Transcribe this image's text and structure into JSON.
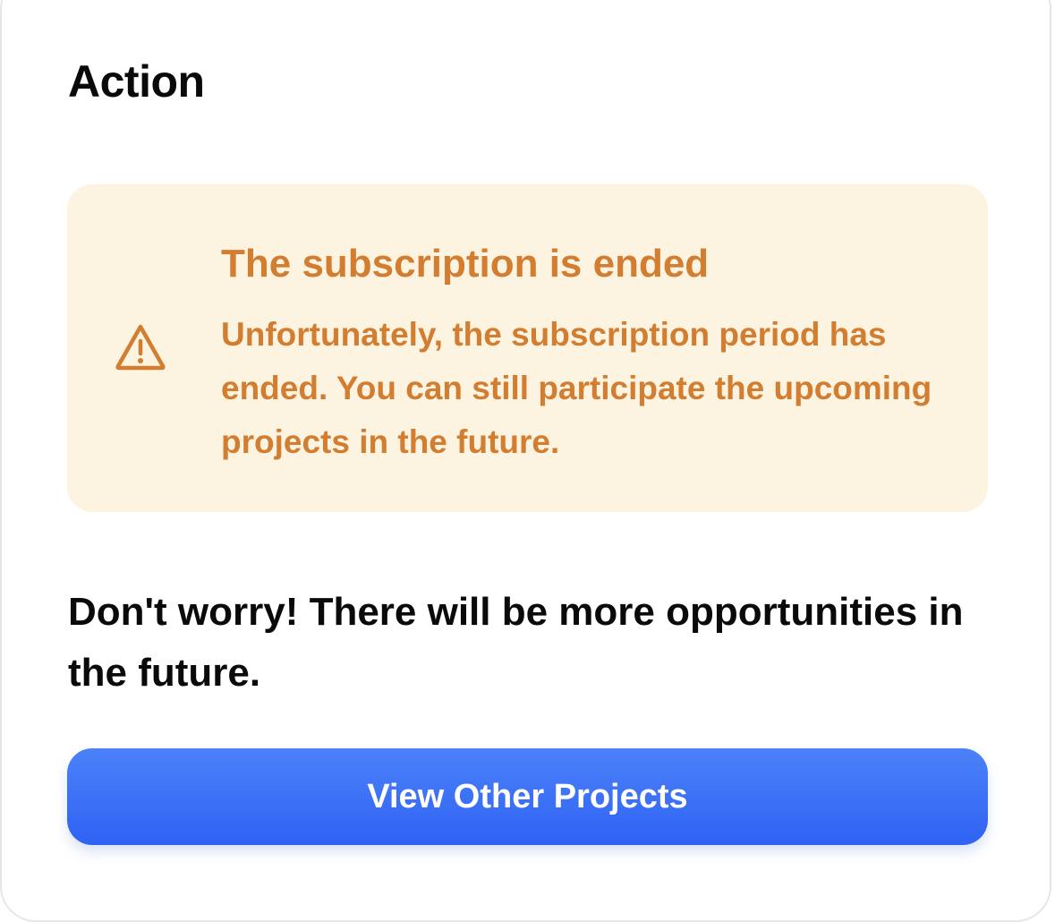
{
  "heading": "Action",
  "alert": {
    "icon": "warning-triangle-icon",
    "title": "The subscription is ended",
    "body": "Unfortunately, the subscription period has ended. You can still participate the upcoming projects in the future.",
    "color": "#d27d30",
    "background": "#fcf4e1"
  },
  "message": "Don't worry! There will be more opportunities in the future.",
  "button": {
    "label": "View Other Projects",
    "color": "#3568f5"
  }
}
